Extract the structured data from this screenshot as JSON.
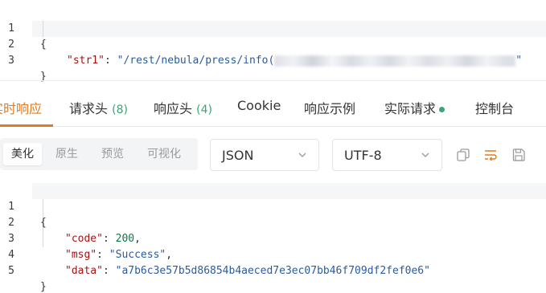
{
  "request_body": {
    "lines": [
      {
        "num": "1",
        "text": "{"
      },
      {
        "num": "2",
        "key": "\"str1\"",
        "sep": ": ",
        "value": "\"/rest/nebula/press/info(",
        "value_end": "\""
      },
      {
        "num": "3",
        "text": "}"
      }
    ]
  },
  "tabs": {
    "realtime_response": "实时响应",
    "request_headers": "请求头",
    "request_headers_count": "(8)",
    "response_headers": "响应头",
    "response_headers_count": "(4)",
    "cookie": "Cookie",
    "response_example": "响应示例",
    "actual_request": "实际请求",
    "console": "控制台"
  },
  "view_modes": {
    "beautify": "美化",
    "raw": "原生",
    "preview": "预览",
    "visualize": "可视化"
  },
  "format_select": {
    "value": "JSON"
  },
  "encoding_select": {
    "value": "UTF-8"
  },
  "icons": {
    "copy": "copy-icon",
    "wrap": "wrap-lines-icon",
    "save": "save-icon",
    "chevron": "chevron-down-icon"
  },
  "colors": {
    "accent": "#e07b1f",
    "count_green": "#3aa676",
    "json_key": "#a31515",
    "json_string": "#2a5b9e",
    "json_number": "#0a7a4a"
  },
  "response_body": {
    "lines": [
      {
        "num": "1",
        "text": "{"
      },
      {
        "num": "2",
        "key": "\"code\"",
        "sep": ": ",
        "number": "200",
        "trail": ","
      },
      {
        "num": "3",
        "key": "\"msg\"",
        "sep": ": ",
        "value": "\"Success\"",
        "trail": ","
      },
      {
        "num": "4",
        "key": "\"data\"",
        "sep": ": ",
        "value": "\"a7b6c3e57b5d86854b4aeced7e3ec07bb46f709df2fef0e6\""
      },
      {
        "num": "5",
        "text": "}"
      }
    ]
  }
}
